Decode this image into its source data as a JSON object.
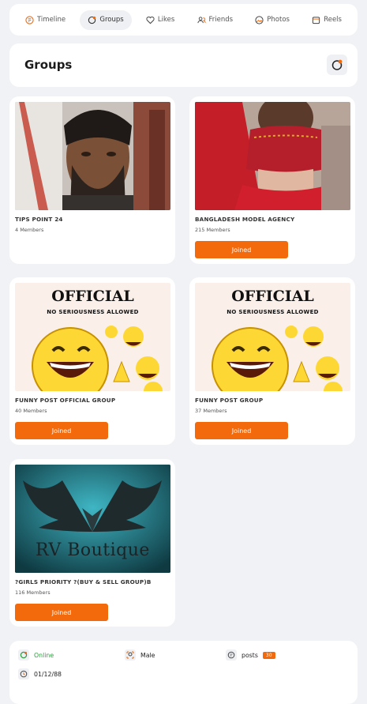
{
  "tabs": [
    {
      "label": "Timeline",
      "icon": "timeline-icon",
      "active": false
    },
    {
      "label": "Groups",
      "icon": "groups-icon",
      "active": true
    },
    {
      "label": "Likes",
      "icon": "heart-icon",
      "active": false
    },
    {
      "label": "Friends",
      "icon": "friends-icon",
      "active": false
    },
    {
      "label": "Photos",
      "icon": "photos-icon",
      "active": false
    },
    {
      "label": "Reels",
      "icon": "reels-icon",
      "active": false
    }
  ],
  "header": {
    "title": "Groups",
    "icon": "groups-icon"
  },
  "groups": [
    {
      "name": "TIPS POINT 24",
      "members": "4 Members",
      "button": "",
      "image": "man-portrait"
    },
    {
      "name": "BANGLADESH MODEL AGENCY",
      "members": "215 Members",
      "button": "Joined",
      "image": "red-dress-photo"
    },
    {
      "name": "FUNNY POST OFFICIAL GROUP",
      "members": "40 Members",
      "button": "Joined",
      "image": "laughing-emoji-meme"
    },
    {
      "name": "FUNNY POST GROUP",
      "members": "37 Members",
      "button": "Joined",
      "image": "laughing-emoji-meme"
    },
    {
      "name": "?GIRLS PRIORITY ?(BUY & SELL GROUP)B",
      "members": "116 Members",
      "button": "Joined",
      "image": "rv-boutique-logo"
    }
  ],
  "meme_text": {
    "line1": "OFFICIAL",
    "line2": "NO SERIOUSNESS ALLOWED"
  },
  "logo_text": "RV Boutique",
  "info": {
    "status": "Online",
    "gender": "Male",
    "posts_label": "posts",
    "posts_count": "30",
    "birthday": "01/12/88"
  },
  "colors": {
    "accent": "#f26a0c",
    "online": "#2e9b3e",
    "background": "#f0f2f5"
  }
}
